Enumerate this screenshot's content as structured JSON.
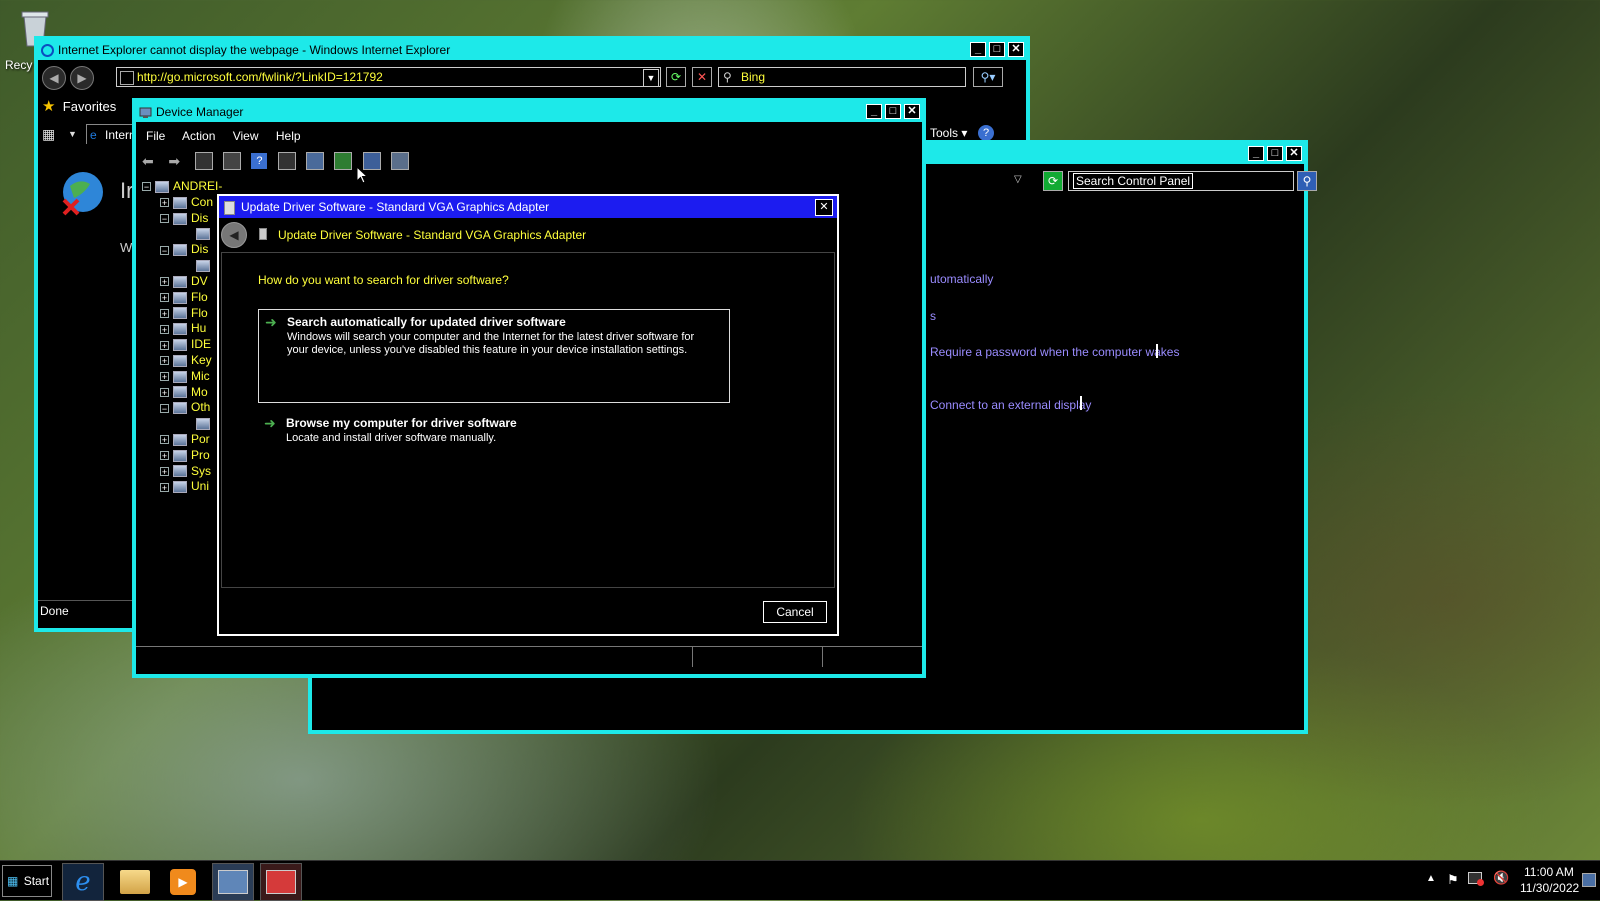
{
  "desktop": {
    "recycle_label": "Recy"
  },
  "ie": {
    "title": "Internet Explorer cannot display the webpage - Windows Internet Explorer",
    "url": "http://go.microsoft.com/fwlink/?LinkID=121792",
    "search_placeholder": "Bing",
    "favorites_label": "Favorites",
    "tab_label": "Intern",
    "tools_label": "Tools",
    "heading_partial": "Ir",
    "body_partial": "W",
    "status": "Done"
  },
  "control_panel": {
    "search_placeholder": "Search Control Panel",
    "links": [
      "utomatically",
      "s",
      "Require a password when the computer wakes",
      "Connect to an external display"
    ]
  },
  "device_manager": {
    "title": "Device Manager",
    "menu": [
      "File",
      "Action",
      "View",
      "Help"
    ],
    "tree_root": "ANDREI-PC",
    "tree_items": [
      {
        "label": "Con",
        "expander": "+"
      },
      {
        "label": "Dis",
        "expander": "−"
      },
      {
        "label": "",
        "expander": ""
      },
      {
        "label": "Dis",
        "expander": "−"
      },
      {
        "label": "",
        "expander": ""
      },
      {
        "label": "DV",
        "expander": "+"
      },
      {
        "label": "Flo",
        "expander": "+"
      },
      {
        "label": "Flo",
        "expander": "+"
      },
      {
        "label": "Hu",
        "expander": "+"
      },
      {
        "label": "IDE",
        "expander": "+"
      },
      {
        "label": "Key",
        "expander": "+"
      },
      {
        "label": "Mic",
        "expander": "+"
      },
      {
        "label": "Mo",
        "expander": "+"
      },
      {
        "label": "Oth",
        "expander": "−"
      },
      {
        "label": "",
        "expander": ""
      },
      {
        "label": "Por",
        "expander": "+"
      },
      {
        "label": "Pro",
        "expander": "+"
      },
      {
        "label": "Sys",
        "expander": "+"
      },
      {
        "label": "Uni",
        "expander": "+"
      }
    ]
  },
  "dialog": {
    "title": "Update Driver Software - Standard VGA Graphics Adapter",
    "header": "Update Driver Software - Standard VGA Graphics Adapter",
    "question": "How do you want to search for driver software?",
    "option1": {
      "title": "Search automatically for updated driver software",
      "desc": "Windows will search your computer and the Internet for the latest driver software for your device, unless you've disabled this feature in your device installation settings."
    },
    "option2": {
      "title": "Browse my computer for driver software",
      "desc": "Locate and install driver software manually."
    },
    "cancel": "Cancel"
  },
  "taskbar": {
    "start": "Start",
    "time": "11:00 AM",
    "date": "11/30/2022"
  }
}
